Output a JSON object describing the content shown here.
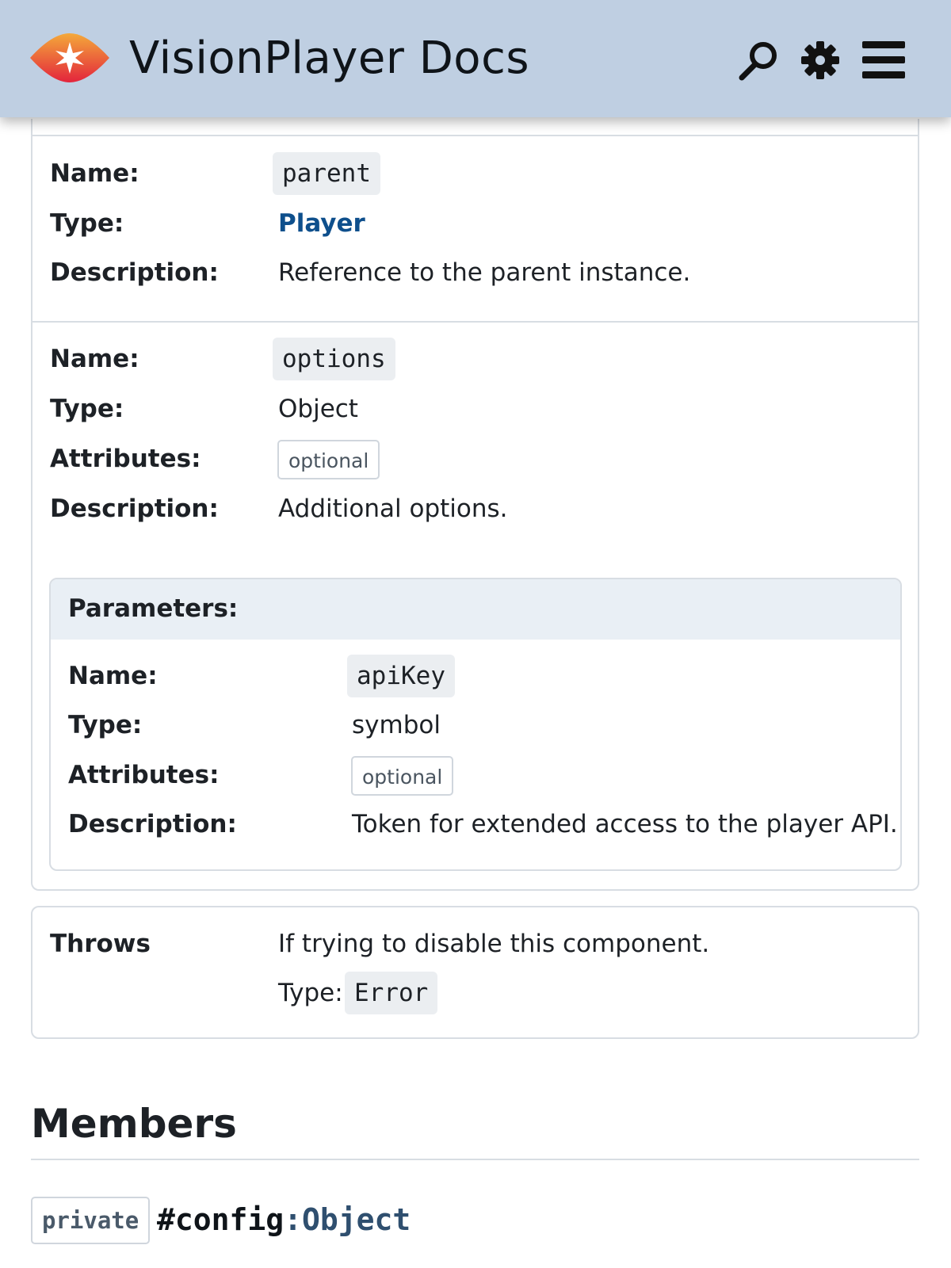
{
  "header": {
    "title": "VisionPlayer Docs",
    "icons": [
      "logo-icon",
      "search-icon",
      "gear-icon",
      "menu-icon"
    ],
    "logo_colors": [
      "#e8283c",
      "#f4a93a"
    ]
  },
  "params": [
    {
      "name_label": "Name:",
      "name": "parent",
      "type_label": "Type:",
      "type": "Player",
      "desc_label": "Description:",
      "desc": "Reference to the parent instance."
    },
    {
      "name_label": "Name:",
      "name": "options",
      "type_label": "Type:",
      "type": "Object",
      "attr_label": "Attributes:",
      "attr": "optional",
      "desc_label": "Description:",
      "desc": "Additional options.",
      "sub": {
        "heading": "Parameters:",
        "name_label": "Name:",
        "name": "apiKey",
        "type_label": "Type:",
        "type": "symbol",
        "attr_label": "Attributes:",
        "attr": "optional",
        "desc_label": "Description:",
        "desc": "Token for extended access to the player API."
      }
    }
  ],
  "throws": {
    "label": "Throws",
    "desc": "If trying to disable this component.",
    "type_label": "Type:",
    "type": "Error"
  },
  "members": {
    "heading": "Members",
    "item": {
      "modifier": "private",
      "name": "#config",
      "colon": ":",
      "type": "Object"
    }
  },
  "colors": {
    "header_bg": "#bfcfe2",
    "link": "#0e4f8c",
    "params_head_bg": "#e9eff5"
  }
}
